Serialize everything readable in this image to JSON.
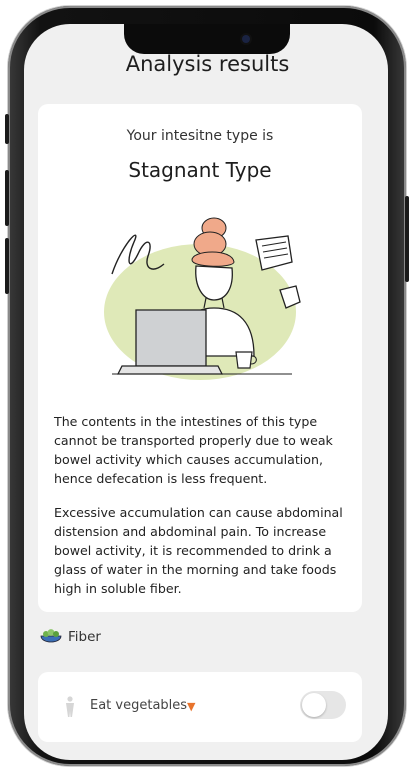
{
  "header": {
    "title": "Analysis results"
  },
  "result": {
    "subtitle": "Your intesitne type is",
    "type_name": "Stagnant Type",
    "description": [
      "The contents in the intestines of this type cannot be transported properly due to weak bowel activity which causes accumulation, hence defecation is less frequent.",
      "Excessive accumulation can cause abdominal distension and abdominal pain. To increase bowel activity, it is recommended to drink a glass of water in the morning and take foods high in soluble fiber."
    ]
  },
  "section": {
    "label": "Fiber",
    "icon": "salad-bowl-icon"
  },
  "habit": {
    "label": "Eat vegetables",
    "caret": "▼",
    "enabled": false
  },
  "colors": {
    "accent": "#e8732c",
    "illustration_bg": "#dfe9b8",
    "hair": "#f0a98a"
  }
}
